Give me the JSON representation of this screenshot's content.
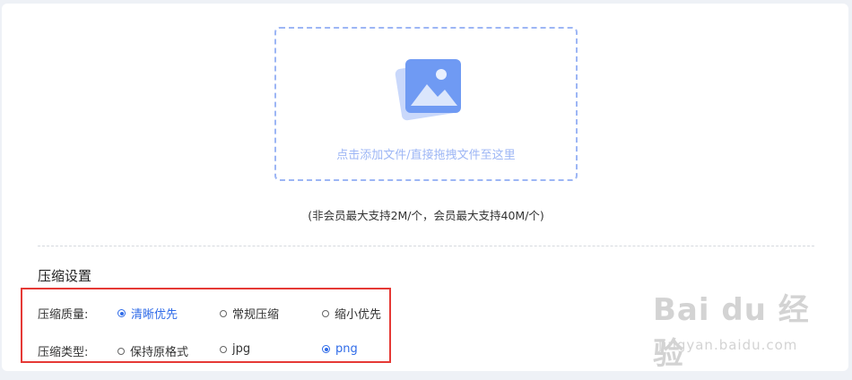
{
  "upload": {
    "prompt": "点击添加文件/直接拖拽文件至这里",
    "limit_note": "(非会员最大支持2M/个，会员最大支持40M/个)",
    "icon": "image-icon"
  },
  "settings": {
    "title": "压缩设置",
    "quality": {
      "label": "压缩质量:",
      "options": [
        "清晰优先",
        "常规压缩",
        "缩小优先"
      ],
      "selected": "清晰优先"
    },
    "type": {
      "label": "压缩类型:",
      "options": [
        "保持原格式",
        "jpg",
        "png"
      ],
      "selected": "png"
    }
  },
  "watermark": {
    "main": "Bai du 经验",
    "sub": "jingyan.baidu.com"
  },
  "colors": {
    "accent": "#2f6be8",
    "dropzone_border": "#9db6f5",
    "highlight_box": "#e53935"
  }
}
